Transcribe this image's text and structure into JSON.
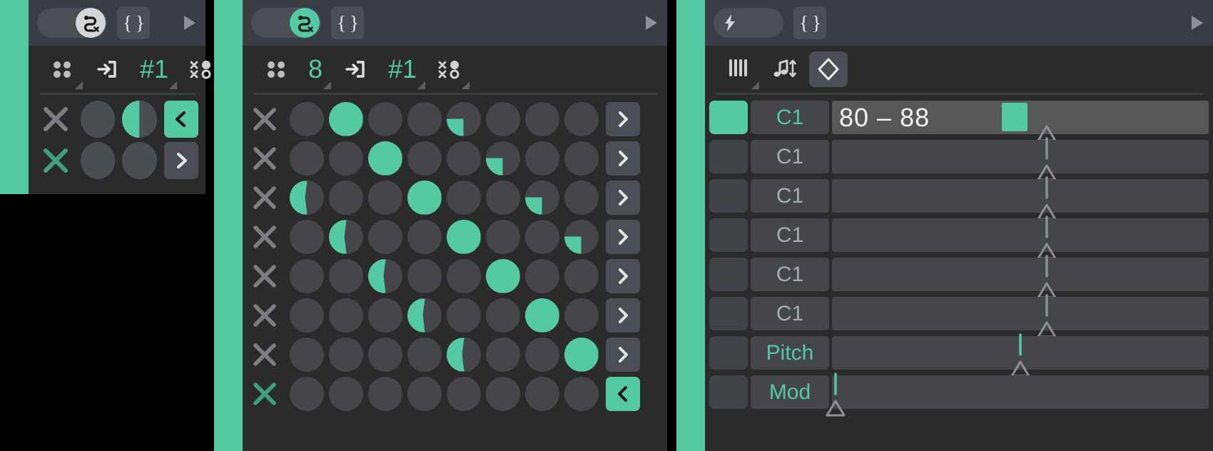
{
  "colors": {
    "accent": "#55c9a3",
    "panel_bg": "#2b2b2b",
    "topbar_bg": "#3a3d44",
    "cell_off": "#4a4d52",
    "button_bg": "#4b4e55",
    "page_bg": "#000000",
    "text_muted": "#a9acaf",
    "text_light": "#e3e5e7"
  },
  "panels": [
    {
      "id": "left-panel",
      "topbar": {
        "toggle": {
          "name": "route-toggle",
          "icon": "route-x-icon",
          "state": "on",
          "knob_style": "light"
        },
        "braces_button": {
          "name": "braces-button",
          "label": "{ }"
        },
        "play_icon": "play-triangle-icon"
      },
      "toolbar": [
        {
          "name": "pads-selector",
          "icon": "four-dots-icon",
          "value": "",
          "has_corner": true
        },
        {
          "name": "input-selector",
          "icon": "login-arrow-icon",
          "value": "",
          "has_corner": false
        },
        {
          "name": "channel-selector",
          "icon": "",
          "value": "#1",
          "value_color": "accent",
          "has_corner": true
        },
        {
          "name": "randomize-selector",
          "icon": "dots-crosses-icon",
          "value": "",
          "has_corner": true
        }
      ],
      "rows": [
        {
          "name": "track-row-1",
          "x_active": false,
          "cells": [
            0,
            50
          ],
          "arrow": {
            "glyph": "<",
            "active": true
          }
        },
        {
          "name": "track-row-2",
          "x_active": true,
          "cells": [
            0,
            0
          ],
          "arrow": {
            "glyph": ">",
            "active": false
          }
        }
      ]
    },
    {
      "id": "middle-panel",
      "topbar": {
        "toggle": {
          "name": "route-toggle",
          "icon": "route-x-icon",
          "state": "on",
          "knob_style": "teal"
        },
        "braces_button": {
          "name": "braces-button",
          "label": "{ }"
        },
        "play_icon": "play-triangle-icon"
      },
      "toolbar": [
        {
          "name": "pads-selector",
          "icon": "four-dots-icon",
          "value": "",
          "has_corner": false
        },
        {
          "name": "step-count-selector",
          "icon": "",
          "value": "8",
          "value_color": "accent",
          "has_corner": true
        },
        {
          "name": "input-selector",
          "icon": "login-arrow-icon",
          "value": "",
          "has_corner": false
        },
        {
          "name": "channel-selector",
          "icon": "",
          "value": "#1",
          "value_color": "accent",
          "has_corner": true
        },
        {
          "name": "randomize-selector",
          "icon": "dots-crosses-icon",
          "value": "",
          "has_corner": true
        }
      ],
      "rows": [
        {
          "name": "seq-row-1",
          "x_active": false,
          "cells": [
            0,
            100,
            0,
            0,
            25,
            0,
            0,
            0
          ],
          "arrow": {
            "glyph": ">",
            "active": false
          }
        },
        {
          "name": "seq-row-2",
          "x_active": false,
          "cells": [
            0,
            0,
            100,
            0,
            0,
            25,
            0,
            0
          ],
          "arrow": {
            "glyph": ">",
            "active": false
          }
        },
        {
          "name": "seq-row-3",
          "x_active": false,
          "cells": [
            45,
            0,
            0,
            100,
            0,
            0,
            25,
            0
          ],
          "arrow": {
            "glyph": ">",
            "active": false
          }
        },
        {
          "name": "seq-row-4",
          "x_active": false,
          "cells": [
            0,
            45,
            0,
            0,
            100,
            0,
            0,
            25
          ],
          "arrow": {
            "glyph": ">",
            "active": false
          }
        },
        {
          "name": "seq-row-5",
          "x_active": false,
          "cells": [
            0,
            0,
            45,
            0,
            0,
            100,
            0,
            0
          ],
          "arrow": {
            "glyph": ">",
            "active": false
          }
        },
        {
          "name": "seq-row-6",
          "x_active": false,
          "cells": [
            0,
            0,
            0,
            45,
            0,
            0,
            100,
            0
          ],
          "arrow": {
            "glyph": ">",
            "active": false
          }
        },
        {
          "name": "seq-row-7",
          "x_active": false,
          "cells": [
            0,
            0,
            0,
            0,
            45,
            0,
            0,
            100
          ],
          "arrow": {
            "glyph": ">",
            "active": false
          }
        },
        {
          "name": "seq-row-8",
          "x_active": true,
          "cells": [
            0,
            0,
            0,
            0,
            0,
            0,
            0,
            0
          ],
          "arrow": {
            "glyph": "<",
            "active": true
          }
        }
      ]
    },
    {
      "id": "right-panel",
      "topbar": {
        "toggle": {
          "name": "velocity-toggle",
          "icon": "lightning-bolt-icon",
          "state": "off",
          "knob_style": "dark"
        },
        "braces_button": {
          "name": "braces-button",
          "label": "{ }"
        },
        "play_icon": "play-triangle-icon"
      },
      "toolbar": [
        {
          "name": "keys-selector",
          "icon": "piano-keys-icon",
          "value": "",
          "has_corner": true
        },
        {
          "name": "note-transpose-selector",
          "icon": "note-updown-icon",
          "value": "",
          "has_corner": false
        },
        {
          "name": "range-mode-button",
          "icon": "diamond-icon",
          "value": "",
          "boxed": true,
          "has_corner": false
        }
      ],
      "rows": [
        {
          "name": "param-row-1",
          "led": true,
          "label": "C1",
          "label_active": true,
          "value": "80 – 88",
          "track_active": true,
          "chip_pct": 45,
          "handle_pct": 57,
          "stem": false
        },
        {
          "name": "param-row-2",
          "led": false,
          "label": "C1",
          "label_active": false,
          "value": "",
          "track_active": false,
          "chip_pct": null,
          "handle_pct": 57,
          "stem": true
        },
        {
          "name": "param-row-3",
          "led": false,
          "label": "C1",
          "label_active": false,
          "value": "",
          "track_active": false,
          "chip_pct": null,
          "handle_pct": 57,
          "stem": true
        },
        {
          "name": "param-row-4",
          "led": false,
          "label": "C1",
          "label_active": false,
          "value": "",
          "track_active": false,
          "chip_pct": null,
          "handle_pct": 57,
          "stem": true
        },
        {
          "name": "param-row-5",
          "led": false,
          "label": "C1",
          "label_active": false,
          "value": "",
          "track_active": false,
          "chip_pct": null,
          "handle_pct": 57,
          "stem": true
        },
        {
          "name": "param-row-6",
          "led": false,
          "label": "C1",
          "label_active": false,
          "value": "",
          "track_active": false,
          "chip_pct": null,
          "handle_pct": 57,
          "stem": true
        },
        {
          "name": "param-row-pitch",
          "led": false,
          "label": "Pitch",
          "label_active": true,
          "value": "",
          "track_active": false,
          "chip_pct": null,
          "handle_pct": 50,
          "stem": true,
          "stem_teal": true
        },
        {
          "name": "param-row-mod",
          "led": false,
          "label": "Mod",
          "label_active": true,
          "value": "",
          "track_active": false,
          "chip_pct": null,
          "handle_pct": 1,
          "stem": true,
          "stem_teal": true
        }
      ]
    }
  ]
}
